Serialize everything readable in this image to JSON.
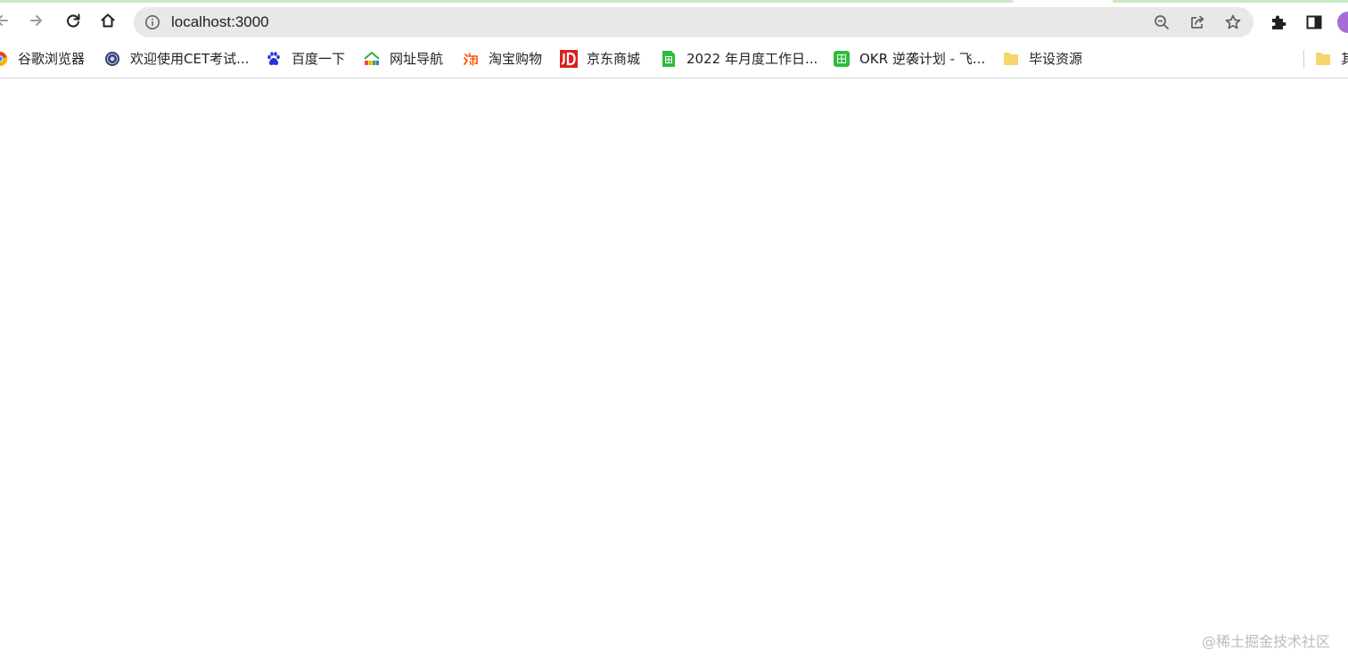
{
  "address_bar": {
    "url": "localhost:3000"
  },
  "toolbar": {
    "icons": [
      "back-icon",
      "forward-icon",
      "reload-icon",
      "home-icon",
      "info-icon",
      "zoom-icon",
      "share-icon",
      "star-icon",
      "extensions-icon",
      "side-panel-icon",
      "profile-avatar"
    ]
  },
  "bookmarks": [
    {
      "label": "谷歌浏览器",
      "icon": "chrome-icon"
    },
    {
      "label": "欢迎使用CET考试...",
      "icon": "cet-seal-icon"
    },
    {
      "label": "百度一下",
      "icon": "baidu-paw-icon"
    },
    {
      "label": "网址导航",
      "icon": "2345-house-icon"
    },
    {
      "label": "淘宝购物",
      "icon": "taobao-icon"
    },
    {
      "label": "京东商城",
      "icon": "jd-icon"
    },
    {
      "label": "2022 年月度工作日...",
      "icon": "sheet-icon"
    },
    {
      "label": "OKR 逆袭计划 - 飞...",
      "icon": "table-icon"
    },
    {
      "label": "毕设资源",
      "icon": "folder-icon"
    },
    {
      "label": "其",
      "icon": "folder-icon"
    }
  ],
  "watermark": "@稀土掘金技术社区",
  "colors": {
    "omnibox_bg": "#e8e8e8",
    "tab_strip": "#c9ebc1",
    "avatar": "#a76cd6",
    "jd_red": "#d9221c",
    "sheet_green": "#2fbb3b",
    "folder_yellow": "#f7d66b"
  }
}
